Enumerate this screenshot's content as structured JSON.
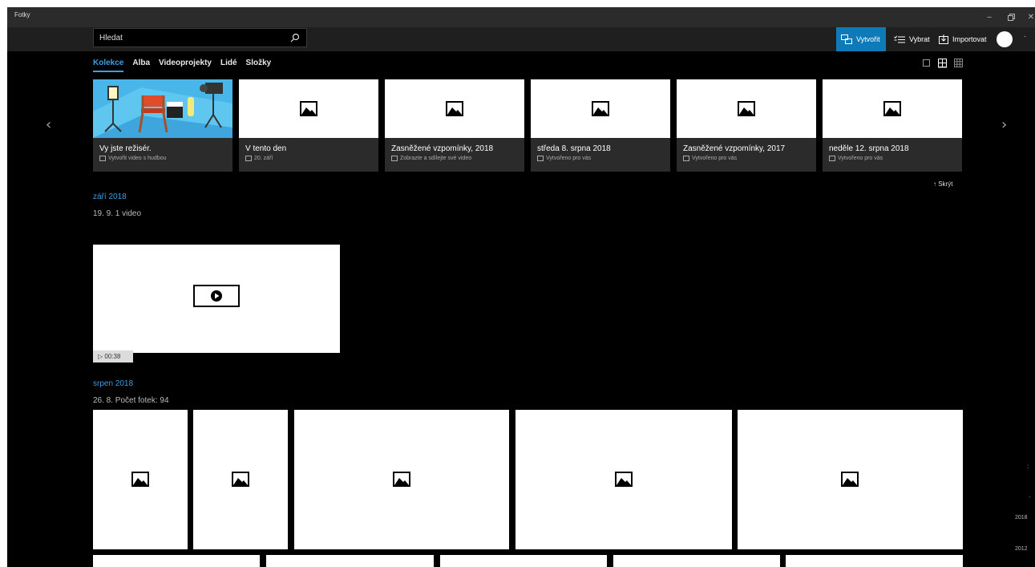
{
  "window": {
    "title": "Fotky"
  },
  "commandbar": {
    "search_placeholder": "Hledat",
    "create_label": "Vytvořit",
    "select_label": "Vybrat",
    "import_label": "Importovat"
  },
  "tabs": [
    {
      "label": "Kolekce",
      "active": true
    },
    {
      "label": "Alba"
    },
    {
      "label": "Videoprojekty"
    },
    {
      "label": "Lidé"
    },
    {
      "label": "Složky"
    }
  ],
  "cards": [
    {
      "title": "Vy jste režisér.",
      "subtitle": "Vytvořit video s hudbou"
    },
    {
      "title": "V tento den",
      "subtitle": "20. září"
    },
    {
      "title": "Zasněžené vzpomínky, 2018",
      "subtitle": "Zobrazte a sdílejte své video"
    },
    {
      "title": "středa 8. srpna 2018",
      "subtitle": "Vytvořeno pro vás"
    },
    {
      "title": "Zasněžené vzpomínky, 2017",
      "subtitle": "Vytvořeno pro vás"
    },
    {
      "title": "neděle 12. srpna 2018",
      "subtitle": "Vytvořeno pro vás"
    }
  ],
  "hide_label": "↑  Skrýt",
  "sections": [
    {
      "month": "září 2018",
      "date": "19. 9.   1 video"
    },
    {
      "month": "srpen 2018",
      "date": "26. 8.   Počet fotek: 94"
    }
  ],
  "video": {
    "duration": "▷  00:38"
  },
  "timeline": {
    "years": [
      "2018",
      "2012"
    ]
  },
  "colors": {
    "accent": "#3aa0e0",
    "active_button": "#0e7ab8",
    "background": "#000000"
  }
}
